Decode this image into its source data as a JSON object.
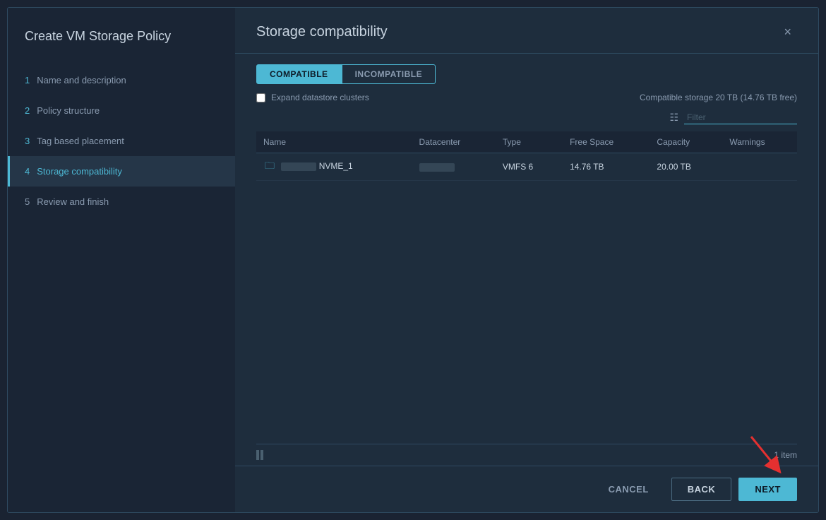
{
  "sidebar": {
    "title": "Create VM Storage Policy",
    "items": [
      {
        "id": "name-description",
        "step": "1",
        "label": "Name and description",
        "state": "completed"
      },
      {
        "id": "policy-structure",
        "step": "2",
        "label": "Policy structure",
        "state": "completed"
      },
      {
        "id": "tag-placement",
        "step": "3",
        "label": "Tag based placement",
        "state": "completed"
      },
      {
        "id": "storage-compat",
        "step": "4",
        "label": "Storage compatibility",
        "state": "active"
      },
      {
        "id": "review-finish",
        "step": "5",
        "label": "Review and finish",
        "state": "default"
      }
    ]
  },
  "main": {
    "title": "Storage compatibility",
    "close_label": "×",
    "tabs": [
      {
        "id": "compatible",
        "label": "COMPATIBLE",
        "active": true
      },
      {
        "id": "incompatible",
        "label": "INCOMPATIBLE",
        "active": false
      }
    ],
    "expand_label": "Expand datastore clusters",
    "compatible_info": "Compatible storage 20 TB (14.76 TB free)",
    "filter_placeholder": "Filter",
    "table": {
      "columns": [
        "Name",
        "Datacenter",
        "Type",
        "Free Space",
        "Capacity",
        "Warnings"
      ],
      "rows": [
        {
          "name": "NVME_1",
          "datacenter": "BLURRED",
          "type": "VMFS 6",
          "free_space": "14.76 TB",
          "capacity": "20.00 TB",
          "warnings": ""
        }
      ]
    },
    "item_count": "1 item"
  },
  "actions": {
    "cancel_label": "CANCEL",
    "back_label": "BACK",
    "next_label": "NEXT"
  }
}
